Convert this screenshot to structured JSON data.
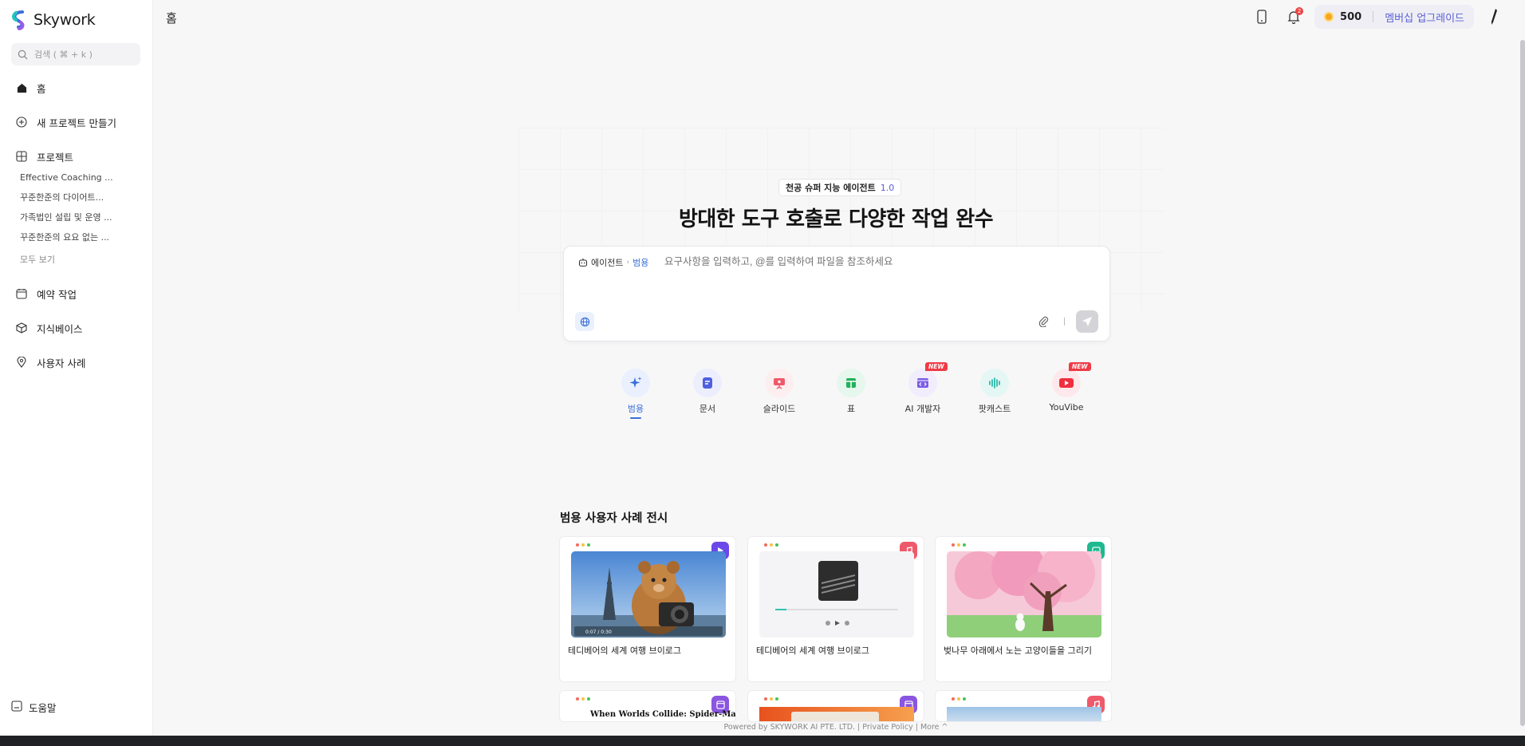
{
  "app": {
    "brand": "Skywork"
  },
  "sidebar": {
    "search_placeholder": "검색 ( ⌘ + k )",
    "home": "홈",
    "new_project": "새 프로젝트 만들기",
    "projects": "프로젝트",
    "project_items": [
      "Effective Coaching ...",
      "꾸준한준의 다이어트...",
      "가족법인 설립 및 운영 ...",
      "꾸준한준의 요요 없는 ..."
    ],
    "view_all": "모두 보기",
    "scheduled": "예약 작업",
    "knowledge": "지식베이스",
    "use_cases": "사용자 사례",
    "help": "도움말"
  },
  "header": {
    "title": "홈",
    "notification_count": "2",
    "credits": "500",
    "upgrade": "멤버십 업그레이드"
  },
  "hero": {
    "pill_label": "천공 슈퍼 지능 에이전트",
    "pill_version": "1.0",
    "title": "방대한 도구 호출로 다양한 작업 완수"
  },
  "composer": {
    "agent_label": "에이전트",
    "mode_label": "범용",
    "placeholder": "요구사항을 입력하고, @를 입력하여 파일을 참조하세요"
  },
  "tools": [
    {
      "label": "범용",
      "icon": "sparkle-icon",
      "color": "#3b6fd8",
      "bg": "#eaf0fe",
      "new": false,
      "active": true
    },
    {
      "label": "문서",
      "icon": "doc-icon",
      "color": "#4f5fe0",
      "bg": "#eceefd",
      "new": false,
      "active": false
    },
    {
      "label": "슬라이드",
      "icon": "slides-icon",
      "color": "#ef5a6a",
      "bg": "#fdeef0",
      "new": false,
      "active": false
    },
    {
      "label": "표",
      "icon": "table-icon",
      "color": "#21b35c",
      "bg": "#e6f7ed",
      "new": false,
      "active": false
    },
    {
      "label": "AI 개발자",
      "icon": "code-icon",
      "color": "#7b5be8",
      "bg": "#f1edfd",
      "new": true,
      "active": false
    },
    {
      "label": "팟캐스트",
      "icon": "audio-wave-icon",
      "color": "#18b0a0",
      "bg": "#e4f7f4",
      "new": false,
      "active": false
    },
    {
      "label": "YouVibe",
      "icon": "youtube-icon",
      "color": "#ef2f3f",
      "bg": "#fde9eb",
      "new": true,
      "active": false
    }
  ],
  "new_badge": "NEW",
  "showcase": {
    "title": "범용 사용자 사례 전시",
    "cards": [
      {
        "title": "테디베어의 세계 여행 브이로그",
        "badge": "play-icon",
        "badge_color": "#6b48e8",
        "video_time": "0:07 / 0:30"
      },
      {
        "title": "테디베어의 세계 여행 브이로그",
        "badge": "music-icon",
        "badge_color": "#ef5a6a"
      },
      {
        "title": "벚나무 아래에서 노는 고양이들을 그리기",
        "badge": "image-icon",
        "badge_color": "#1fb890"
      }
    ],
    "cards_row2": [
      {
        "heading": "When Worlds Collide: Spider-Man",
        "badge": "slides-icon",
        "badge_color": "#8a55e0"
      },
      {
        "badge": "slides-icon",
        "badge_color": "#8a55e0"
      },
      {
        "badge": "music-icon",
        "badge_color": "#ef5a6a"
      }
    ]
  },
  "footer": {
    "text": "Powered by SKYWORK AI PTE. LTD. | Private Policy | More ^"
  }
}
